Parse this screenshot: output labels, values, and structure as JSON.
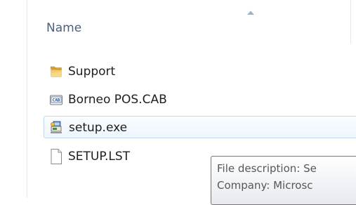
{
  "column": {
    "name_label": "Name",
    "sort": "ascending"
  },
  "files": [
    {
      "name": "Support",
      "icon": "folder-icon"
    },
    {
      "name": "Borneo POS.CAB",
      "icon": "cab-file-icon"
    },
    {
      "name": "setup.exe",
      "icon": "setup-exe-icon",
      "selected": true
    },
    {
      "name": "SETUP.LST",
      "icon": "document-icon"
    }
  ],
  "tooltip": {
    "description": "File description: Se",
    "company": "Company: Microsc"
  },
  "colors": {
    "header_text": "#4c607a",
    "selection_border": "#c5d7ee",
    "selection_fill": "#eef5fd"
  }
}
